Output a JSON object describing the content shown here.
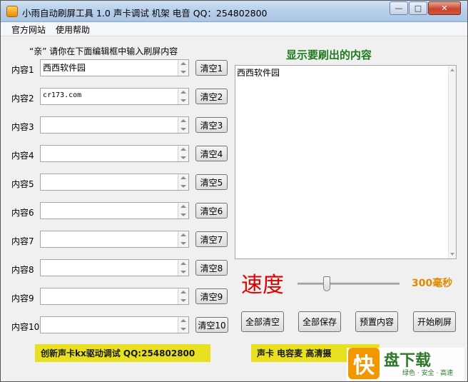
{
  "window": {
    "title": "小雨自动刷屏工具 1.0   声卡调试 机架 电音 QQ：254802800",
    "minimize": "—",
    "maximize": "□",
    "close": "✕"
  },
  "menu": {
    "items": [
      "官方网站",
      "使用帮助"
    ]
  },
  "hint": "“亲” 请你在下面编辑框中输入刷屏内容",
  "rows": [
    {
      "label": "内容1",
      "value": "西西软件园",
      "button": "清空1"
    },
    {
      "label": "内容2",
      "value": "cr173.com",
      "button": "清空2"
    },
    {
      "label": "内容3",
      "value": "",
      "button": "清空3"
    },
    {
      "label": "内容4",
      "value": "",
      "button": "清空4"
    },
    {
      "label": "内容5",
      "value": "",
      "button": "清空5"
    },
    {
      "label": "内容6",
      "value": "",
      "button": "清空6"
    },
    {
      "label": "内容7",
      "value": "",
      "button": "清空7"
    },
    {
      "label": "内容8",
      "value": "",
      "button": "清空8"
    },
    {
      "label": "内容9",
      "value": "",
      "button": "清空9"
    },
    {
      "label": "内容10",
      "value": "",
      "button": "清空10"
    }
  ],
  "display": {
    "title": "显示要刷出的内容",
    "text": "西西软件园"
  },
  "speed": {
    "label": "速度",
    "value": "300毫秒",
    "slider_level": 0.29
  },
  "actions": [
    "全部清空",
    "全部保存",
    "预置内容",
    "开始刷屏"
  ],
  "banners": {
    "left": "创新声卡kx驱动调试 QQ:254802800",
    "right": "声卡  电容麦  高清摄"
  },
  "watermark": {
    "logo_char": "快",
    "main": "盘下载",
    "sub": "绿色 · 安全 · 高速"
  },
  "colors": {
    "display_title": "#1f7a1f",
    "speed_label": "#e00000",
    "speed_value": "#e08a00",
    "banner": "#e8e020"
  }
}
